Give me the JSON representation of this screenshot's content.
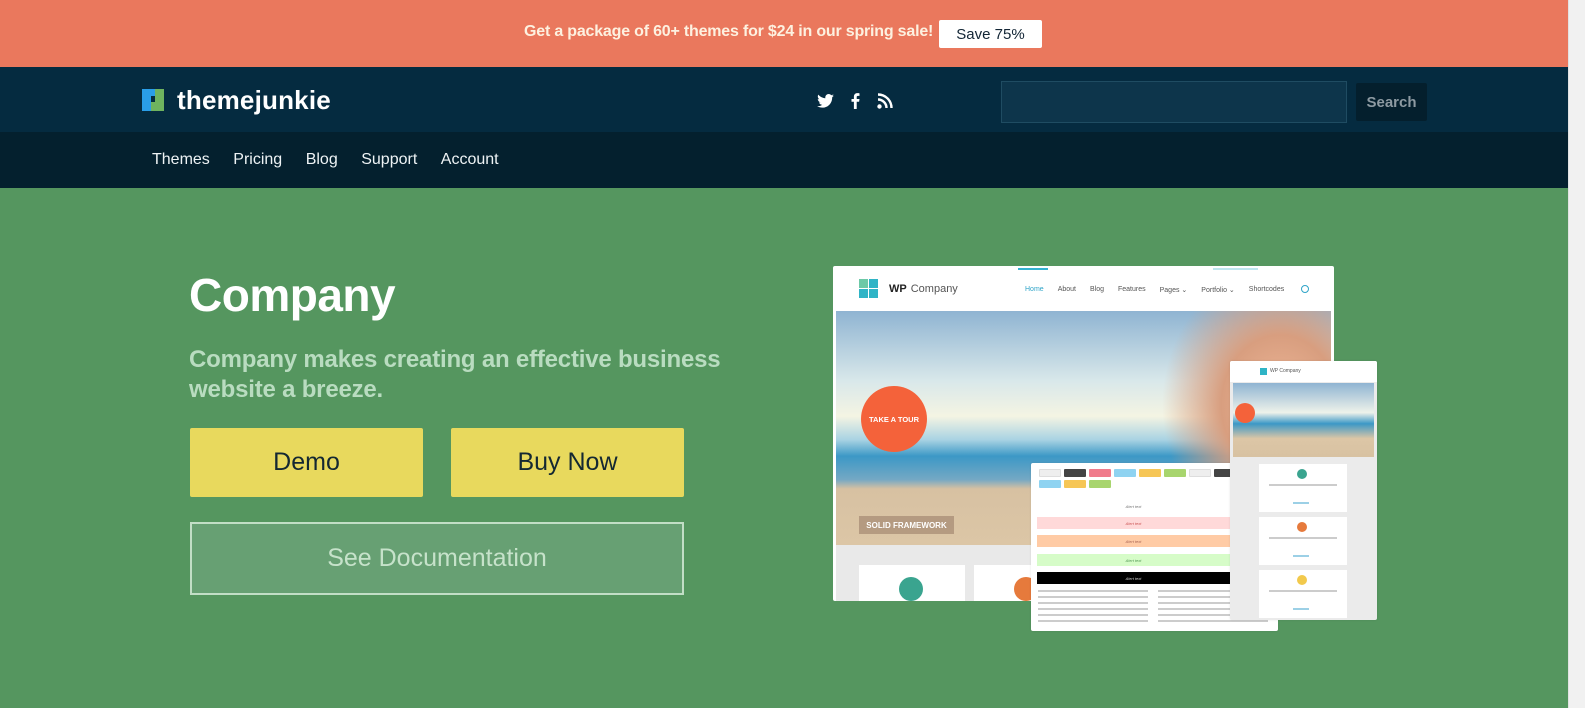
{
  "promo": {
    "text": "Get a package of 60+ themes for $24 in our spring sale!",
    "button_label": "Save 75%"
  },
  "header": {
    "logo_text": "themejunkie",
    "social_icons": [
      "twitter-icon",
      "facebook-icon",
      "rss-icon"
    ],
    "search_value": "",
    "search_placeholder": "",
    "search_button_label": "Search"
  },
  "nav": {
    "items": [
      "Themes",
      "Pricing",
      "Blog",
      "Support",
      "Account"
    ]
  },
  "hero": {
    "title": "Company",
    "subtitle": "Company makes creating an effective business website a breeze.",
    "demo_label": "Demo",
    "buy_label": "Buy Now",
    "docs_label": "See Documentation"
  },
  "mockup": {
    "brand_bold": "WP",
    "brand_name": "Company",
    "nav_items": [
      "Home",
      "About",
      "Blog",
      "Features",
      "Pages ⌄",
      "Portfolio ⌄",
      "Shortcodes"
    ],
    "tour_label": "TAKE A TOUR",
    "framework_label": "SOLID FRAMEWORK",
    "alert_text": "Alert text",
    "mobile_brand": "WP Company"
  },
  "colors": {
    "promo_bg": "#ea785d",
    "header_bg": "#052b40",
    "nav_bg": "#04202e",
    "hero_bg": "#55965f",
    "button_yellow": "#e8d95d"
  }
}
